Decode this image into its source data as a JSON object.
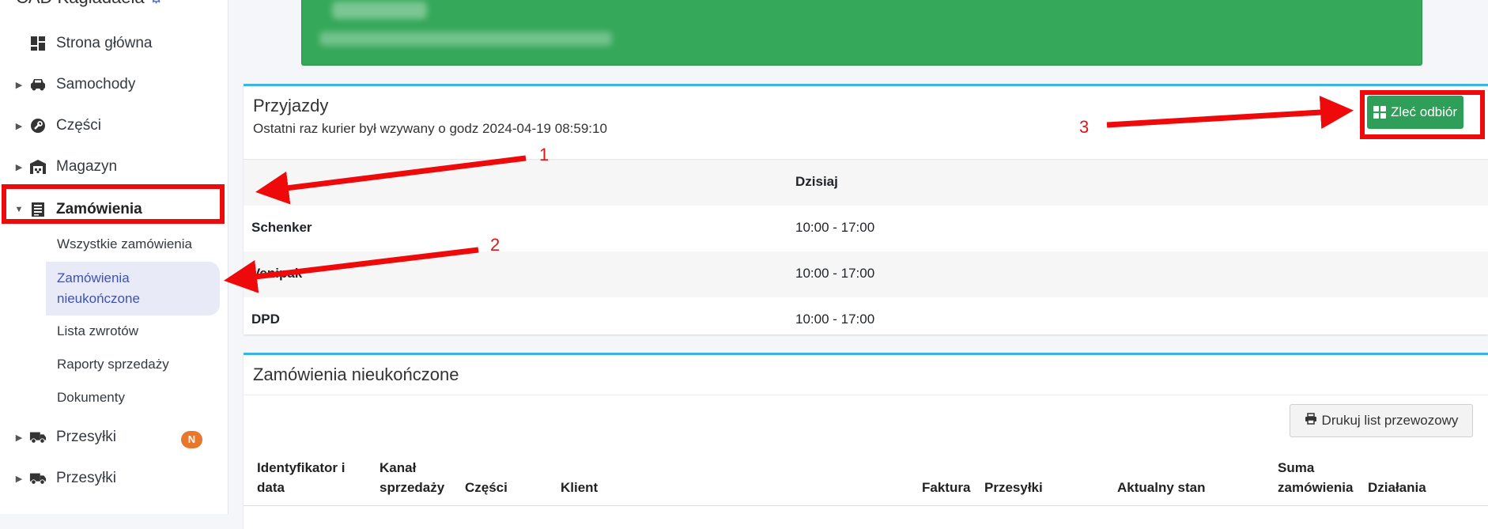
{
  "sidebar": {
    "brand": "CAD Kagiadaeia",
    "items": [
      {
        "label": "Strona główna",
        "icon": "dashboard-icon"
      },
      {
        "label": "Samochody",
        "icon": "car-icon"
      },
      {
        "label": "Części",
        "icon": "wrench-icon"
      },
      {
        "label": "Magazyn",
        "icon": "warehouse-icon"
      },
      {
        "label": "Zamówienia",
        "icon": "list-icon"
      },
      {
        "label": "Przesyłki",
        "icon": "truck-icon",
        "badge": "N"
      },
      {
        "label": "Przesyłki",
        "icon": "truck-icon"
      }
    ],
    "subitems": [
      "Wszystkie zamówienia",
      "Zamówienia nieukończone",
      "Lista zwrotów",
      "Raporty sprzedaży",
      "Dokumenty"
    ]
  },
  "arrivals": {
    "title": "Przyjazdy",
    "subtitle": "Ostatni raz kurier był wzywany o godz 2024-04-19 08:59:10",
    "button_label": "Zleć odbiór",
    "column_header": "Dzisiaj",
    "rows": [
      {
        "carrier": "Schenker",
        "hours": "10:00 - 17:00"
      },
      {
        "carrier": "Venipak",
        "hours": "10:00 - 17:00"
      },
      {
        "carrier": "DPD",
        "hours": "10:00 - 17:00"
      }
    ]
  },
  "orders": {
    "title": "Zamówienia nieukończone",
    "print_button": "Drukuj list przewozowy",
    "columns": [
      "Identyfikator i data",
      "Kanał sprzedaży",
      "Części",
      "Klient",
      "Faktura",
      "Przesyłki",
      "Aktualny stan",
      "Suma zamówienia",
      "Działania"
    ]
  },
  "annotations": {
    "labels": [
      "1",
      "2",
      "3"
    ],
    "color": "#ee0a0a"
  },
  "colors": {
    "accent_green": "#2f9e58",
    "card_border": "#3bb4e5",
    "active_sub": "#3f51b5",
    "badge": "#e8762c"
  }
}
